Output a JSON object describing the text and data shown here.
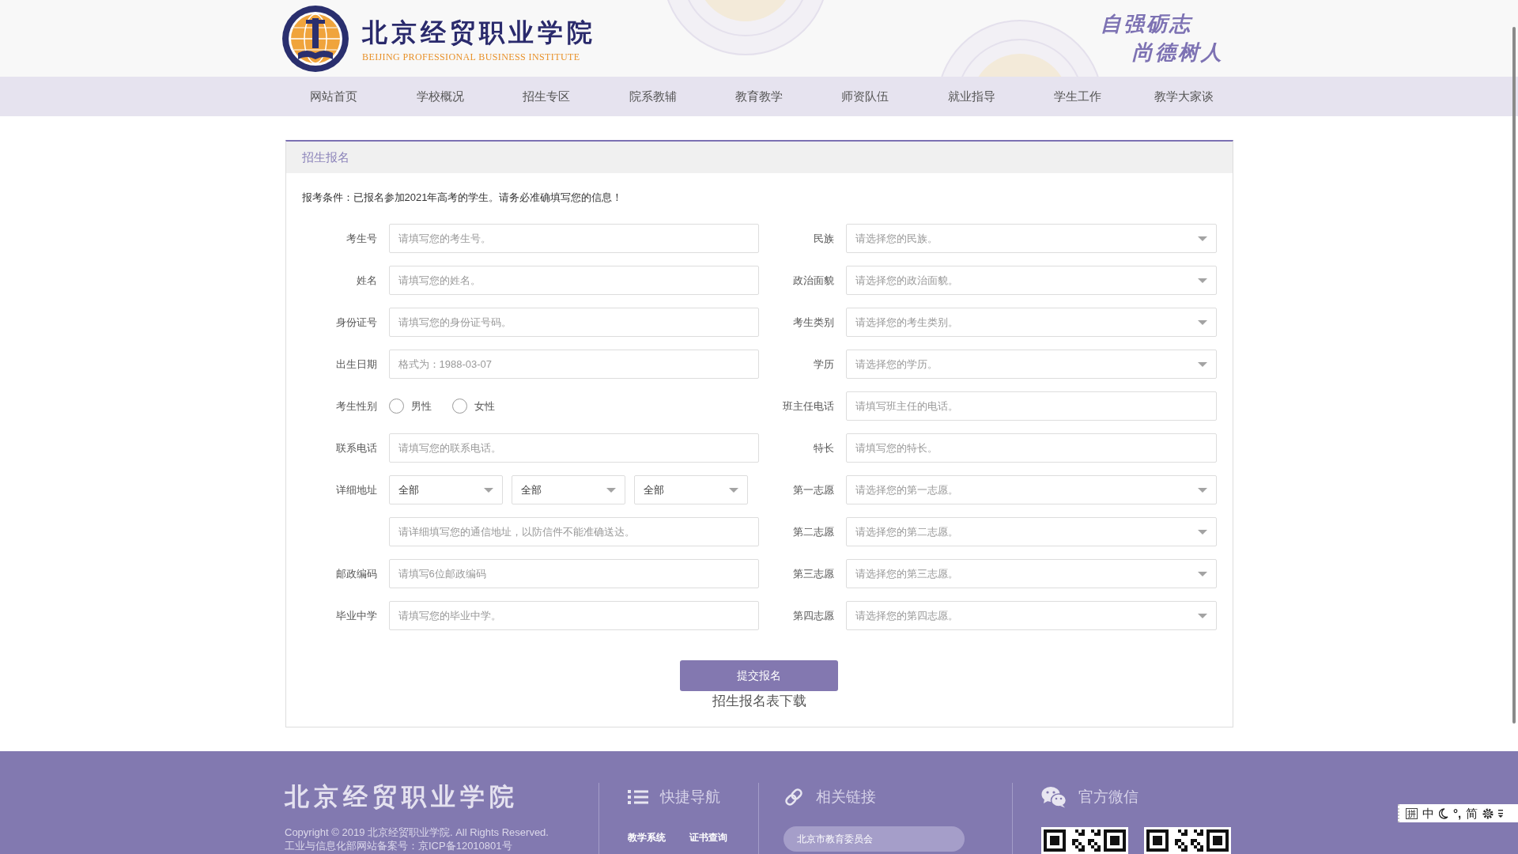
{
  "header": {
    "title": "北京经贸职业学院",
    "subtitle": "BEIJING PROFESSIONAL BUSINESS INSTITUTE",
    "slogan": [
      "自强砺志",
      "尚德树人"
    ]
  },
  "nav": [
    "网站首页",
    "学校概况",
    "招生专区",
    "院系教辅",
    "教育教学",
    "师资队伍",
    "就业指导",
    "学生工作",
    "教学大家谈"
  ],
  "form": {
    "title": "招生报名",
    "notice": "报考条件：已报名参加2021年高考的学生。请务必准确填写您的信息！",
    "left_fields": [
      {
        "kind": "text",
        "label": "考生号",
        "placeholder": "请填写您的考生号。"
      },
      {
        "kind": "text",
        "label": "姓名",
        "placeholder": "请填写您的姓名。"
      },
      {
        "kind": "text",
        "label": "身份证号",
        "placeholder": "请填写您的身份证号码。"
      },
      {
        "kind": "text",
        "label": "出生日期",
        "placeholder": "格式为：1988-03-07"
      },
      {
        "kind": "radio",
        "label": "考生性别",
        "options": [
          {
            "label": "男性",
            "selected": false
          },
          {
            "label": "女性",
            "selected": false
          }
        ]
      },
      {
        "kind": "text",
        "label": "联系电话",
        "placeholder": "请填写您的联系电话。"
      },
      {
        "kind": "address",
        "label": "详细地址",
        "selects": [
          {
            "value": "全部"
          },
          {
            "value": "全部"
          },
          {
            "value": "全部"
          }
        ],
        "placeholder": "请详细填写您的通信地址，以防信件不能准确送达。"
      },
      {
        "kind": "text",
        "label": "邮政编码",
        "placeholder": "请填写6位邮政编码"
      },
      {
        "kind": "text",
        "label": "毕业中学",
        "placeholder": "请填写您的毕业中学。"
      }
    ],
    "right_fields": [
      {
        "kind": "select",
        "label": "民族",
        "placeholder": "请选择您的民族。"
      },
      {
        "kind": "select",
        "label": "政治面貌",
        "placeholder": "请选择您的政治面貌。"
      },
      {
        "kind": "select",
        "label": "考生类别",
        "placeholder": "请选择您的考生类别。"
      },
      {
        "kind": "select",
        "label": "学历",
        "placeholder": "请选择您的学历。"
      },
      {
        "kind": "text",
        "label": "班主任电话",
        "placeholder": "请填写班主任的电话。"
      },
      {
        "kind": "text",
        "label": "特长",
        "placeholder": "请填写您的特长。"
      },
      {
        "kind": "select",
        "label": "第一志愿",
        "placeholder": "请选择您的第一志愿。"
      },
      {
        "kind": "select",
        "label": "第二志愿",
        "placeholder": "请选择您的第二志愿。"
      },
      {
        "kind": "select",
        "label": "第三志愿",
        "placeholder": "请选择您的第三志愿。"
      },
      {
        "kind": "select",
        "label": "第四志愿",
        "placeholder": "请选择您的第四志愿。"
      }
    ],
    "submit": "提交报名",
    "download_link": "招生报名表下载"
  },
  "footer": {
    "logo_text": "北京经贸职业学院",
    "copyright": "Copyright © 2019 北京经贸职业学院. All Rights Reserved.",
    "icp": "工业与信息化部网站备案号：京ICP备12010801号",
    "sections": [
      {
        "kind": "nav",
        "title": "快捷导航",
        "links": [
          "教学系统",
          "证书查询"
        ]
      },
      {
        "kind": "links",
        "title": "相关链接",
        "links": [
          "北京市教育委员会"
        ]
      },
      {
        "kind": "wechat",
        "title": "官方微信"
      }
    ]
  },
  "ime_toolbar": {
    "mode": "拼",
    "language": "中",
    "punctuation": "°,",
    "script": "简"
  }
}
